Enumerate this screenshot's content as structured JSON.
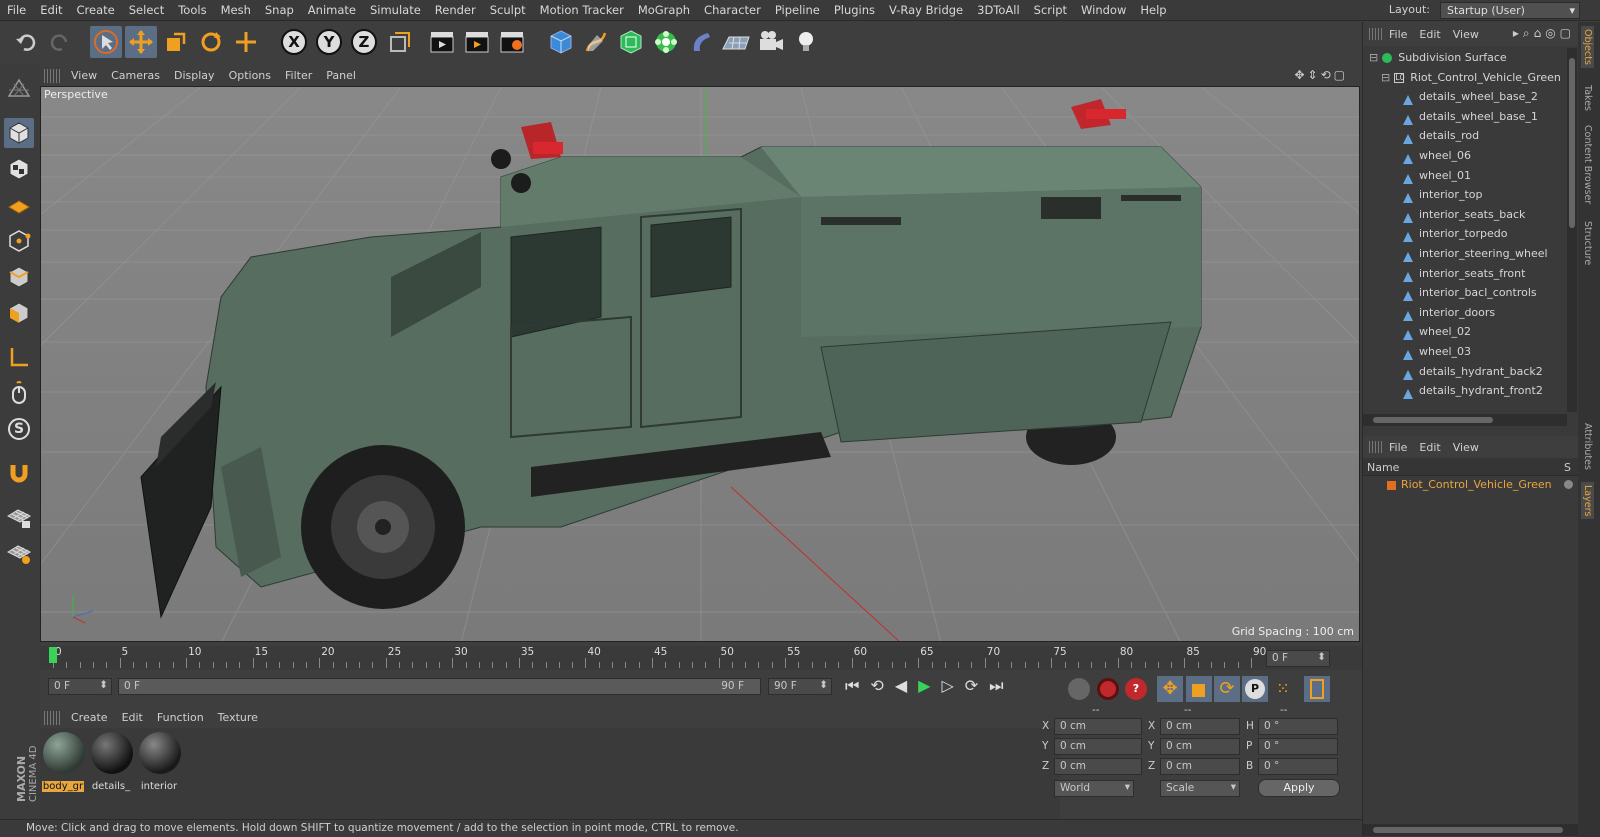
{
  "menubar": {
    "items": [
      "File",
      "Edit",
      "Create",
      "Select",
      "Tools",
      "Mesh",
      "Snap",
      "Animate",
      "Simulate",
      "Render",
      "Sculpt",
      "Motion Tracker",
      "MoGraph",
      "Character",
      "Pipeline",
      "Plugins",
      "V-Ray Bridge",
      "3DToAll",
      "Script",
      "Window",
      "Help"
    ],
    "layout_label": "Layout:",
    "layout_value": "Startup (User)"
  },
  "toolbar": {
    "axis_x": "X",
    "axis_y": "Y",
    "axis_z": "Z"
  },
  "viewport": {
    "menu": [
      "View",
      "Cameras",
      "Display",
      "Options",
      "Filter",
      "Panel"
    ],
    "camera_label": "Perspective",
    "grid_spacing": "Grid Spacing : 100 cm"
  },
  "timeline": {
    "ticks": [
      "0",
      "5",
      "10",
      "15",
      "20",
      "25",
      "30",
      "35",
      "40",
      "45",
      "50",
      "55",
      "60",
      "65",
      "70",
      "75",
      "80",
      "85",
      "90"
    ],
    "end_field": "0 F",
    "start_frame": "0 F",
    "range_start": "0 F",
    "range_end": "90 F",
    "max_frame": "90 F"
  },
  "material_panel": {
    "menu": [
      "Create",
      "Edit",
      "Function",
      "Texture"
    ],
    "materials": [
      {
        "name": "body_gr",
        "selected": true
      },
      {
        "name": "details_",
        "selected": false
      },
      {
        "name": "interior",
        "selected": false
      }
    ],
    "brand_top": "MAXON",
    "brand_bottom": "CINEMA 4D"
  },
  "coordinates": {
    "header": [
      "--",
      "--",
      "--"
    ],
    "rows": [
      {
        "a": "X",
        "av": "0 cm",
        "b": "X",
        "bv": "0 cm",
        "c": "H",
        "cv": "0 °"
      },
      {
        "a": "Y",
        "av": "0 cm",
        "b": "Y",
        "bv": "0 cm",
        "c": "P",
        "cv": "0 °"
      },
      {
        "a": "Z",
        "av": "0 cm",
        "b": "Z",
        "bv": "0 cm",
        "c": "B",
        "cv": "0 °"
      }
    ],
    "space": "World",
    "mode": "Scale",
    "apply": "Apply"
  },
  "status": "Move: Click and drag to move elements. Hold down SHIFT to quantize movement / add to the selection in point mode, CTRL to remove.",
  "object_manager": {
    "menu": [
      "File",
      "Edit",
      "View"
    ],
    "root": "Subdivision Surface",
    "group": "Riot_Control_Vehicle_Green",
    "children": [
      "details_wheel_base_2",
      "details_wheel_base_1",
      "details_rod",
      "wheel_06",
      "wheel_01",
      "interior_top",
      "interior_seats_back",
      "interior_torpedo",
      "interior_steering_wheel",
      "interior_seats_front",
      "interior_bacl_controls",
      "interior_doors",
      "wheel_02",
      "wheel_03",
      "details_hydrant_back2",
      "details_hydrant_front2"
    ]
  },
  "layer_manager": {
    "menu": [
      "File",
      "Edit",
      "View"
    ],
    "col_name": "Name",
    "col_s": "S",
    "layer": "Riot_Control_Vehicle_Green"
  },
  "side_tabs": [
    "Objects",
    "Takes",
    "Content Browser",
    "Structure",
    "Attributes",
    "Layers"
  ]
}
